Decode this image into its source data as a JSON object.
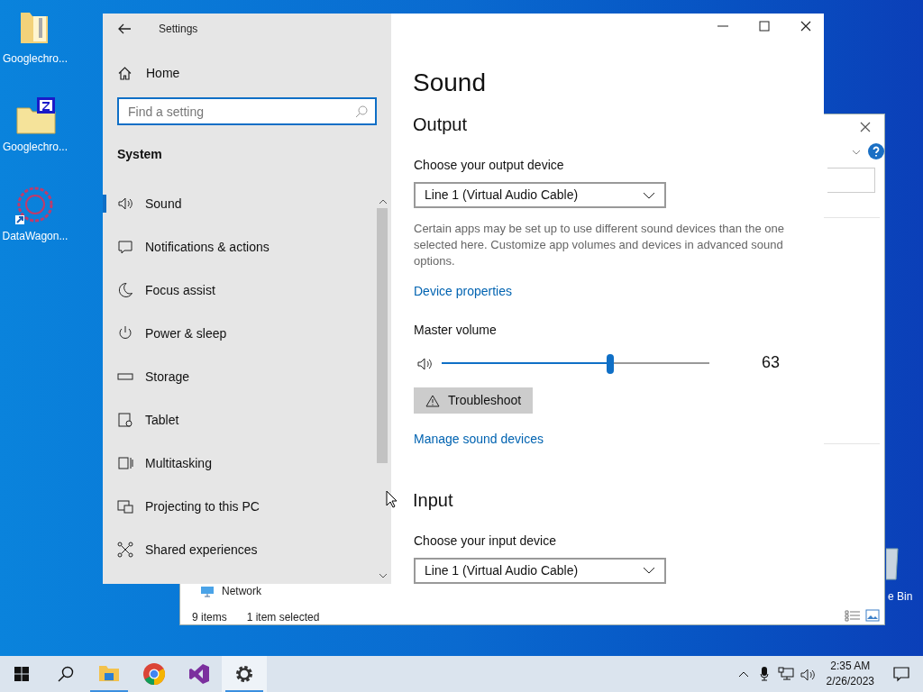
{
  "desktop_icons": [
    {
      "kind": "folder",
      "label": "Googlechro..."
    },
    {
      "kind": "zip",
      "label": "Googlechro..."
    },
    {
      "kind": "app",
      "label": "DataWagon..."
    },
    {
      "kind": "recycle",
      "label": "e Bin"
    }
  ],
  "explorer": {
    "nav_item": "Network",
    "status_bar": [
      "9 items",
      "1 item selected"
    ]
  },
  "settings": {
    "title": "Settings",
    "home": "Home",
    "search": {
      "placeholder": "Find a setting"
    },
    "section": "System",
    "nav": [
      {
        "kind": "sound",
        "label": "Sound",
        "selected": true
      },
      {
        "kind": "notifications",
        "label": "Notifications & actions",
        "selected": false
      },
      {
        "kind": "moon",
        "label": "Focus assist",
        "selected": false
      },
      {
        "kind": "power",
        "label": "Power & sleep",
        "selected": false
      },
      {
        "kind": "storage",
        "label": "Storage",
        "selected": false
      },
      {
        "kind": "tablet",
        "label": "Tablet",
        "selected": false
      },
      {
        "kind": "multitask",
        "label": "Multitasking",
        "selected": false
      },
      {
        "kind": "project",
        "label": "Projecting to this PC",
        "selected": false
      },
      {
        "kind": "shared",
        "label": "Shared experiences",
        "selected": false
      }
    ],
    "page_title": "Sound",
    "output": {
      "heading": "Output",
      "label": "Choose your output device",
      "device": "Line 1 (Virtual Audio Cable)",
      "note": "Certain apps may be set up to use different sound devices than the one selected here. Customize app volumes and devices in advanced sound options.",
      "link": "Device properties",
      "volume_label": "Master volume",
      "volume": {
        "level": 0.63,
        "reading": "63"
      },
      "troubleshoot": "Troubleshoot",
      "manage_link": "Manage sound devices"
    },
    "input": {
      "heading": "Input",
      "label": "Choose your input device",
      "device": "Line 1 (Virtual Audio Cable)"
    }
  },
  "taskbar": {
    "apps": [
      {
        "kind": "explorer",
        "running": true,
        "selected": false
      },
      {
        "kind": "chrome",
        "running": false,
        "selected": false
      },
      {
        "kind": "vs",
        "running": false,
        "selected": false
      },
      {
        "kind": "settings",
        "running": true,
        "selected": true
      }
    ],
    "time": "2:35 AM",
    "date": "2/26/2023"
  }
}
